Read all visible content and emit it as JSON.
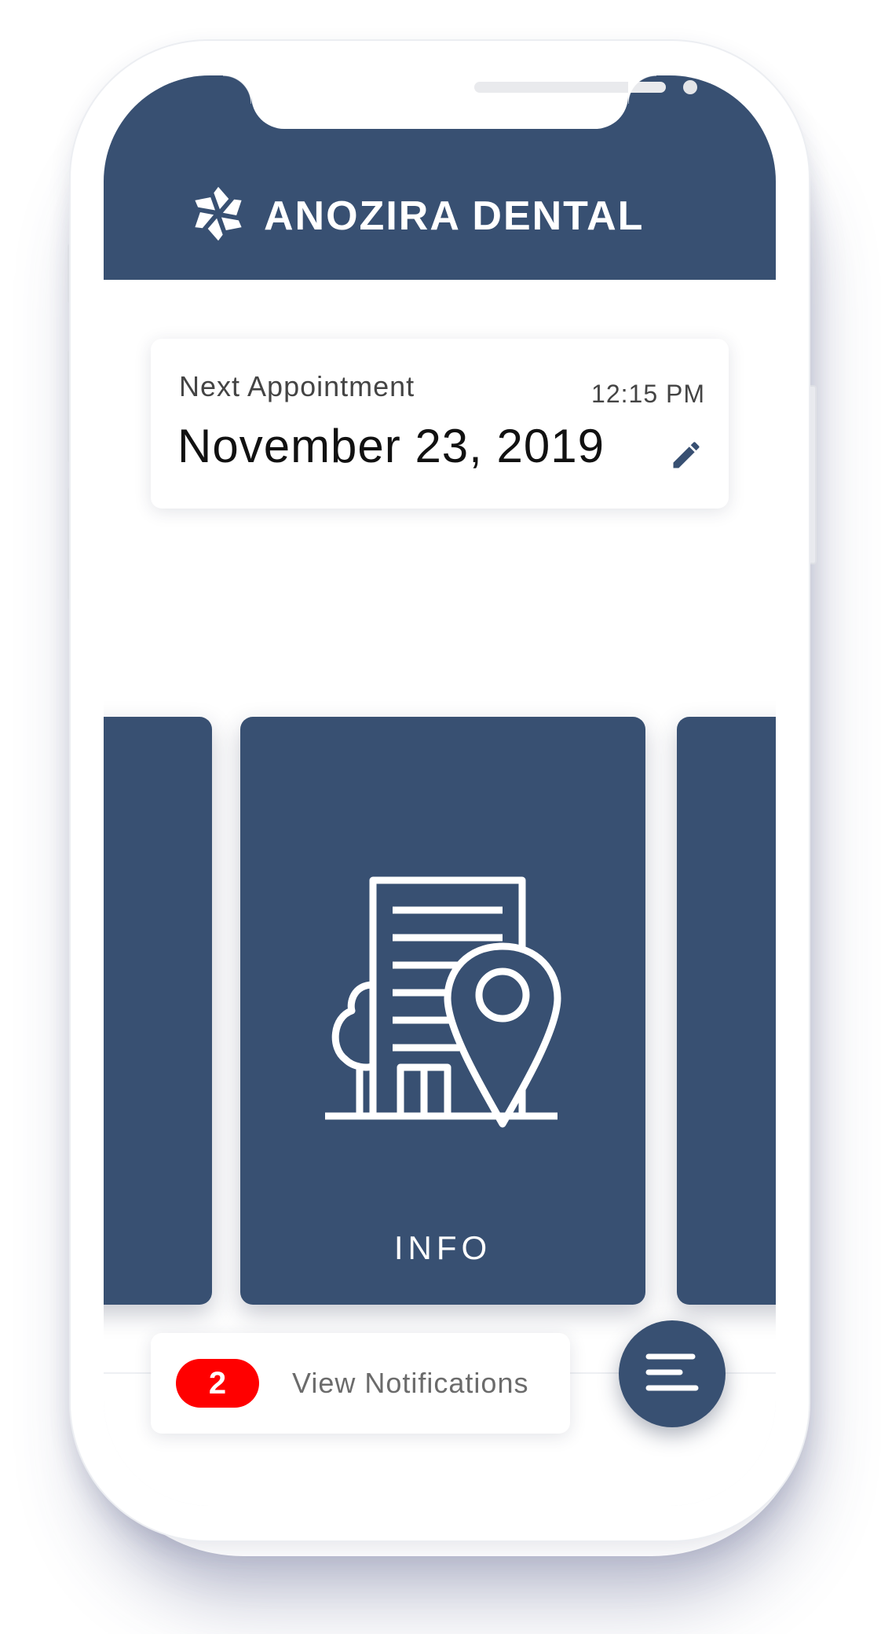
{
  "app": {
    "brand_name": "ANOZIRA DENTAL",
    "logo_icon": "pinwheel-logo-icon"
  },
  "appointment": {
    "label": "Next Appointment",
    "time": "12:15 PM",
    "date": "November 23, 2019",
    "edit_icon": "pencil-icon"
  },
  "carousel": {
    "cards": [
      {
        "label": ""
      },
      {
        "label": "INFO",
        "icon": "building-location-icon"
      },
      {
        "label": ""
      }
    ]
  },
  "notifications": {
    "count": "2",
    "label": "View Notifications"
  },
  "menu": {
    "icon": "menu-lines-icon"
  },
  "colors": {
    "primary": "#385072",
    "badge": "#ff0000",
    "background": "#ffffff"
  }
}
